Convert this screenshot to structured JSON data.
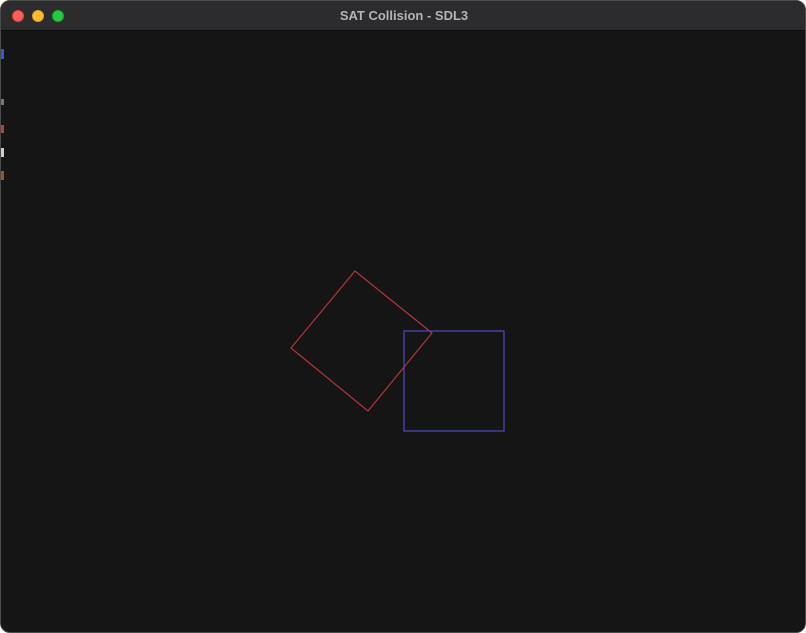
{
  "window": {
    "title": "SAT Collision - SDL3"
  },
  "colors": {
    "background": "#151515",
    "titlebar": "#2c2b2e",
    "title_text": "#b4b4b6",
    "close_button": "#fe5f57",
    "minimize_button": "#febc2e",
    "zoom_button": "#28c840",
    "rotated_square_stroke": "#b0363a",
    "axis_aligned_square_stroke": "#4c4bc4"
  },
  "scene": {
    "shapes": [
      {
        "name": "rotated-red-square",
        "kind": "polygon",
        "color": "#b0363a"
      },
      {
        "name": "axis-aligned-blue-square",
        "kind": "rectangle",
        "color": "#4c4bc4"
      }
    ]
  }
}
